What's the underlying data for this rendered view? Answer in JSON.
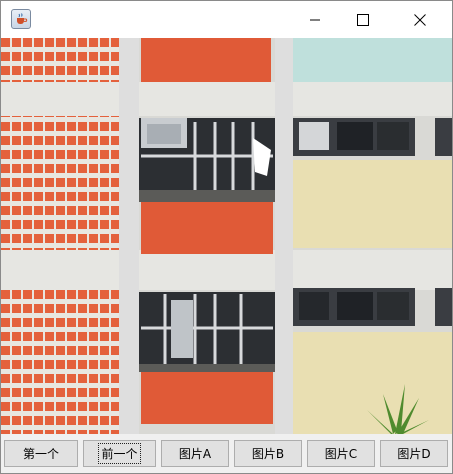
{
  "window": {
    "icons": {
      "app": "java-coffee-cup-icon",
      "minimize": "minimize-icon",
      "maximize": "maximize-icon",
      "close": "close-icon"
    }
  },
  "buttons": {
    "first": "第一个",
    "previous": "前一个",
    "image_a": "图片A",
    "image_b": "图片B",
    "image_c": "图片C",
    "image_d": "图片D"
  },
  "focused_button": "previous",
  "colors": {
    "facade": "#dcdcd8",
    "red_panel": "#e05a37",
    "yellow_panel": "#e9dfb2",
    "teal_panel": "#bfe0dc"
  }
}
